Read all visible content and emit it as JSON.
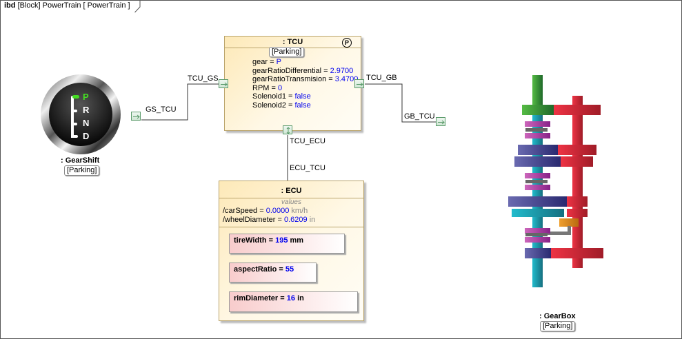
{
  "frame": {
    "kind": "ibd",
    "title": "[Block] PowerTrain [ PowerTrain ]"
  },
  "gearshift": {
    "name": ": GearShift",
    "state": "[Parking]",
    "positions": [
      "P",
      "R",
      "N",
      "D"
    ],
    "selected": "P",
    "selected_color": "#44dd22"
  },
  "tcu": {
    "name": ": TCU",
    "state": "[Parking]",
    "badge": "P",
    "props": [
      {
        "name": "gear",
        "value": "P"
      },
      {
        "name": "gearRatioDifferential",
        "value": "2.9700"
      },
      {
        "name": "gearRatioTransmision",
        "value": "3.4700"
      },
      {
        "name": "RPM",
        "value": "0"
      },
      {
        "name": "Solenoid1",
        "value": "false"
      },
      {
        "name": "Solenoid2",
        "value": "false"
      }
    ]
  },
  "ecu": {
    "name": ": ECU",
    "section": "values",
    "values": [
      {
        "name": "/carSpeed",
        "value": "0.0000",
        "unit": "km/h"
      },
      {
        "name": "/wheelDiameter",
        "value": "0.6209",
        "unit": "in"
      }
    ],
    "parts": [
      {
        "name": "tireWidth",
        "value": "195",
        "unit": "mm"
      },
      {
        "name": "aspectRatio",
        "value": "55",
        "unit": ""
      },
      {
        "name": "rimDiameter",
        "value": "16",
        "unit": "in"
      }
    ]
  },
  "gearbox": {
    "name": ": GearBox",
    "state": "[Parking]"
  },
  "ports": {
    "gs_tcu": "GS_TCU",
    "tcu_gs": "TCU_GS",
    "tcu_gb": "TCU_GB",
    "gb_tcu": "GB_TCU",
    "tcu_ecu": "TCU_ECU",
    "ecu_tcu": "ECU_TCU"
  },
  "colors": {
    "port_border": "#5a9a6a",
    "value_blue": "#0000ee",
    "block_fill": "#fde9b8",
    "part_fill": "#f8cccc"
  }
}
